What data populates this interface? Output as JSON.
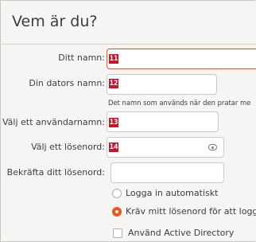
{
  "header": {
    "title": "Vem är du?"
  },
  "form": {
    "name": {
      "label": "Ditt namn:",
      "badge": "11",
      "value": ""
    },
    "computer_name": {
      "label": "Din dators namn:",
      "badge": "12",
      "value": "",
      "hint": "Det namn som används när den pratar me"
    },
    "username": {
      "label": "Välj ett användarnamn:",
      "badge": "13",
      "value": ""
    },
    "password": {
      "label": "Välj ett lösenord:",
      "badge": "14",
      "value": "",
      "reveal_icon": "eye-icon"
    },
    "confirm_password": {
      "label": "Bekräfta ditt lösenord:",
      "value": ""
    }
  },
  "login_options": {
    "auto_login": {
      "label": "Logga in automatiskt",
      "selected": false
    },
    "require_password": {
      "label": "Kräv mitt lösenord för att logga",
      "selected": true
    },
    "active_directory": {
      "label": "Använd Active Directory",
      "checked": false
    }
  },
  "colors": {
    "accent": "#e95420",
    "badge": "#c7162b"
  }
}
